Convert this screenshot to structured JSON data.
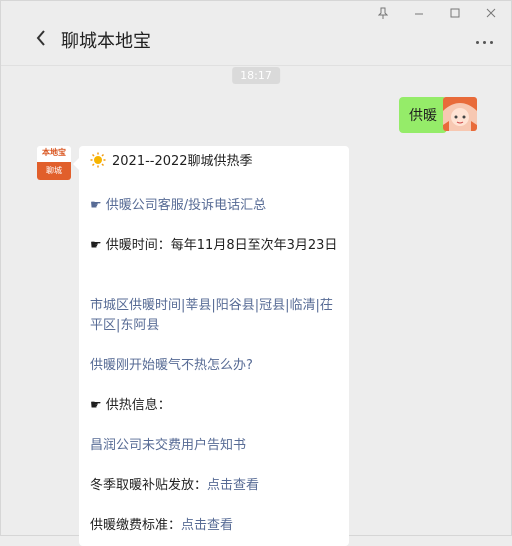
{
  "window_controls": [
    "pin-icon",
    "minimize-icon",
    "maximize-icon",
    "close-icon"
  ],
  "header": {
    "title": "聊城本地宝"
  },
  "chat": {
    "time": "18:17",
    "sent_message": "供暖",
    "sender_avatar_text_top": "本地宝",
    "sender_avatar_text_bottom": "聊城",
    "card": {
      "title": "2021--2022聊城供热季",
      "line1": "☛ 供暖公司客服/投诉电话汇总",
      "line2": "☛ 供暖时间：每年11月8日至次年3月23日",
      "line3": "市城区供暖时间|莘县|阳谷县|冠县|临清|茌平区|东阿县",
      "line4": "供暖刚开始暖气不热怎么办?",
      "line5": "☛ 供热信息：",
      "line6": "昌润公司未交费用户告知书",
      "line7_prefix": "冬季取暖补贴发放：",
      "line7_link": "点击查看",
      "line8_prefix": "供暖缴费标准：",
      "line8_link": "点击查看"
    }
  },
  "colors": {
    "sent_bubble": "#95ec69",
    "link": "#576b95",
    "background": "#ededed"
  }
}
